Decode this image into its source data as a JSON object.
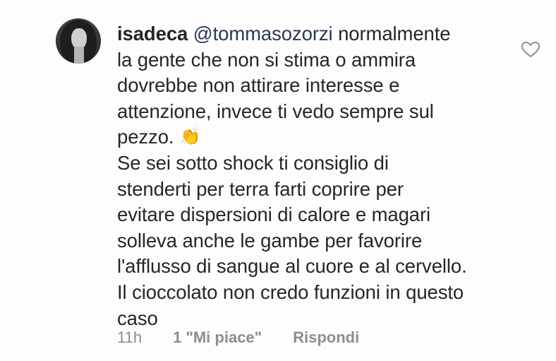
{
  "comment": {
    "username": "isadeca",
    "mention": "@tommasozorzi",
    "first_line_rest": " normalmente",
    "lines": [
      "la gente che non si stima o ammira",
      "dovrebbe non attirare interesse e",
      "attenzione, invece ti vedo sempre sul"
    ],
    "pezzo_text": "pezzo.",
    "emoji": "👏",
    "lines2": [
      "Se sei sotto shock ti consiglio di",
      "stenderti per terra farti coprire per",
      "evitare dispersioni di calore e magari",
      "solleva anche le gambe per favorire",
      "l'afflusso di sangue al cuore e al cervello.",
      "Il cioccolato non credo funzioni in questo",
      "caso"
    ]
  },
  "meta": {
    "time": "11h",
    "likes": "1 \"Mi piace\"",
    "reply": "Rispondi"
  },
  "icons": {
    "heart": "heart-outline-icon",
    "avatar": "profile-avatar"
  },
  "colors": {
    "text": "#262626",
    "meta": "#8e8e8e",
    "heart_stroke": "#8e8e8e"
  }
}
